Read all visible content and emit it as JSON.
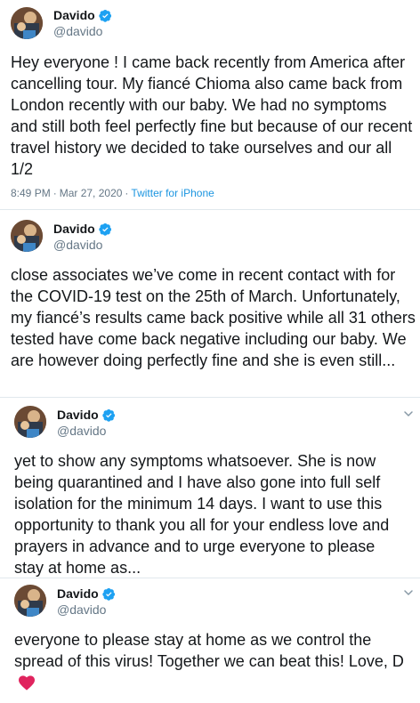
{
  "colors": {
    "verified": "#1da1f2",
    "heart": "#e0245e",
    "link": "#1b95e0",
    "muted": "#657786"
  },
  "tweets": [
    {
      "name": "Davido",
      "handle": "@davido",
      "text": "Hey everyone ! I came back recently from America after cancelling tour. My fiancé Chioma also came back from London recently with our baby. We had no symptoms and still both feel perfectly fine but because of our recent travel history we decided to take ourselves and our all 1/2",
      "time": "8:49 PM",
      "date": "Mar 27, 2020",
      "source": "Twitter for iPhone"
    },
    {
      "name": "Davido",
      "handle": "@davido",
      "text": "close associates we’ve come in recent contact with for the COVID-19 test on the 25th of March. Unfortunately, my fiancé’s results came back positive while all 31 others tested have come back negative including our baby. We are however doing perfectly fine and she is even still..."
    },
    {
      "name": "Davido",
      "handle": "@davido",
      "text": "yet to show any symptoms whatsoever. She is now being quarantined and I have also gone into full self isolation for the minimum 14 days. I want to use this opportunity to thank you all for your endless love and prayers in advance and to urge everyone to please stay at home as..."
    },
    {
      "name": "Davido",
      "handle": "@davido",
      "text": "everyone to please stay at home as we control the spread of this virus! Together we can beat this! Love, D",
      "emoji": "red-heart-icon"
    }
  ]
}
